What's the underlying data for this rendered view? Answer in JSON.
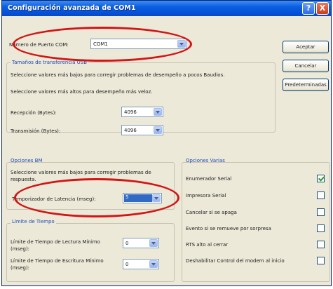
{
  "window": {
    "title": "Configuración avanzada de COM1",
    "help_glyph": "?",
    "close_glyph": "X"
  },
  "com_port": {
    "label": "Número de Puerto COM:",
    "value": "COM1"
  },
  "usb_group": {
    "title": "Tamaños de transferencia USB",
    "hint_low": "Seleccione valores más bajos para corregir problemas de desempeño a pocos Baudios.",
    "hint_high": "Seleccione valores más altos para desempeño más veloz.",
    "rx_label": "Recepción (Bytes):",
    "rx_value": "4096",
    "tx_label": "Transmisión (Bytes):",
    "tx_value": "4096"
  },
  "buttons": {
    "accept": "Aceptar",
    "cancel": "Cancelar",
    "defaults": "Predeterminadas"
  },
  "bm_group": {
    "title": "Opciones BM",
    "hint_line1": "Seleccione valores más bajos para corregir problemas de",
    "hint_line2": "respuesta.",
    "latency_label": "Temporizador de Latencia (mseg):",
    "latency_value": "5"
  },
  "timeouts_group": {
    "title": "Límite de Tiempo",
    "read_label_1": "Límite de Tiempo de Lectura Mínimo",
    "read_label_2": "(mseg):",
    "read_value": "0",
    "write_label_1": "Límite de Tiempo de Escritura Mínimo",
    "write_label_2": "(mseg):",
    "write_value": "0"
  },
  "misc_group": {
    "title": "Opciones Varias",
    "options": [
      {
        "label": "Enumerador Serial",
        "checked": true
      },
      {
        "label": "Impresora Serial",
        "checked": false
      },
      {
        "label": "Cancelar si se apaga",
        "checked": false
      },
      {
        "label": "Evento si se remueve por sorpresa",
        "checked": false
      },
      {
        "label": "RTS alto al cerrar",
        "checked": false
      },
      {
        "label": "Deshabilitar Control del modem al inicio",
        "checked": false
      }
    ]
  },
  "colors": {
    "title_bar": "#0a5fe0",
    "dialog_bg": "#ece9d8",
    "group_title": "#1e4bb5",
    "annotation": "#d31515",
    "selection": "#316ac5"
  }
}
